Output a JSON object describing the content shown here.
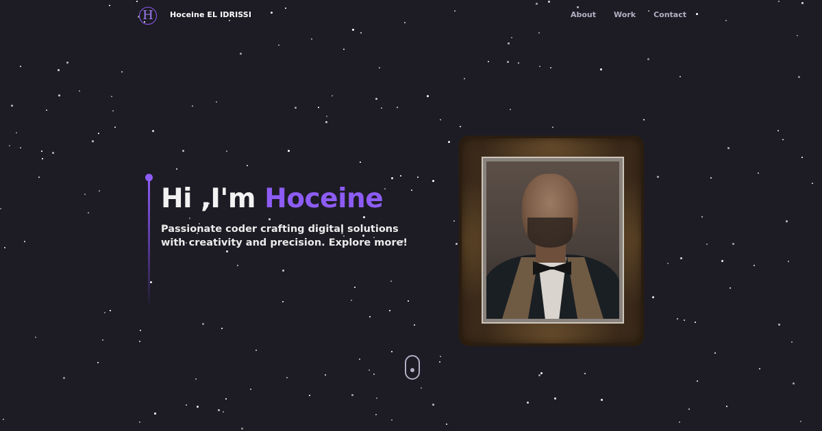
{
  "nav": {
    "logo_letter": "H",
    "brand": "Hoceine EL IDRISSI",
    "links": [
      {
        "label": "About"
      },
      {
        "label": "Work"
      },
      {
        "label": "Contact"
      }
    ]
  },
  "hero": {
    "greeting": "Hi ,I'm",
    "name": "Hoceine",
    "subtitle": "Passionate coder crafting digital solutions with creativity and precision. Explore more!"
  },
  "colors": {
    "background": "#1d1c24",
    "accent": "#8d5cf5",
    "nav_text": "#b4afc4",
    "heading": "#f2f2f2"
  },
  "icons": {
    "logo": "monogram-logo",
    "scroll": "scroll-mouse-icon"
  }
}
